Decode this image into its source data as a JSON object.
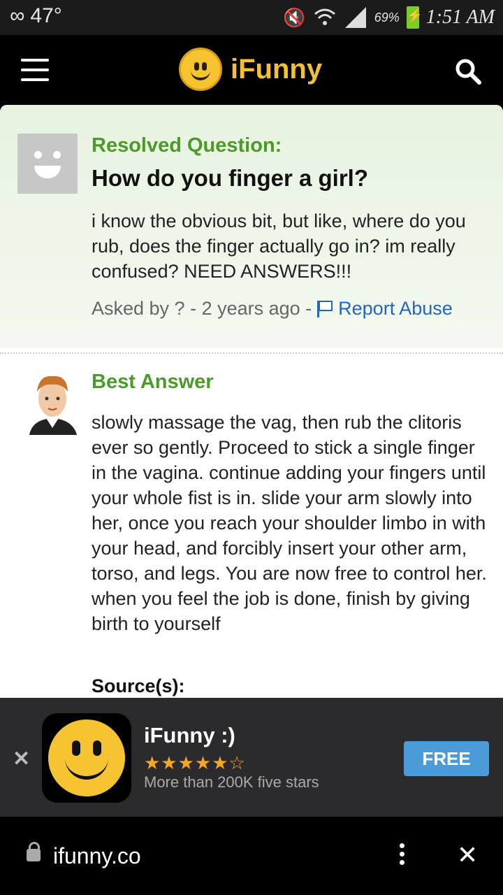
{
  "status_bar": {
    "temperature": "47°",
    "battery_percent": "69%",
    "time": "1:51 AM"
  },
  "app_bar": {
    "logo_text": "iFunny"
  },
  "question": {
    "label": "Resolved Question:",
    "title": "How do you finger a girl?",
    "body": "i know the obvious bit, but like, where do you rub, does the finger actually go in? im really confused? NEED ANSWERS!!!",
    "asked_by": "Asked by ? - 2 years ago -",
    "report_label": "Report Abuse"
  },
  "answer": {
    "label": "Best Answer",
    "body": "slowly massage the vag, then rub the clitoris ever so gently. Proceed to stick a single finger in the vagina. continue adding your fingers until your whole fist is in. slide your arm slowly into her, once you reach your shoulder limbo in with your head, and forcibly insert your other arm, torso, and legs. You are now free to control her. when you feel the job is done, finish by giving birth to yourself",
    "source_label": "Source(s):"
  },
  "ad": {
    "title": "iFunny :)",
    "stars": "★★★★★☆",
    "rating": 4.5,
    "subtitle": "More than 200K five stars",
    "cta": "FREE"
  },
  "browser": {
    "url": "ifunny.co"
  },
  "colors": {
    "accent_yellow": "#f5c02e",
    "green_label": "#4c9a2a",
    "link_blue": "#2466b8",
    "cta_blue": "#4b9bd8"
  }
}
